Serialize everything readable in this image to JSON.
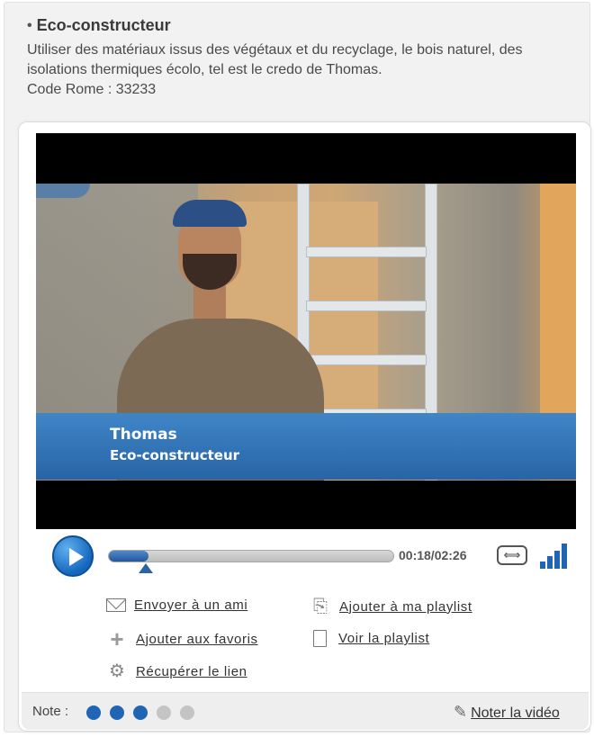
{
  "header": {
    "bullet": "•",
    "title": "Eco-constructeur",
    "description": "Utiliser des matériaux issus des végétaux et du recyclage, le bois naturel, des isolations thermiques écolo, tel est le credo de Thomas.",
    "code": "Code Rome : 33233"
  },
  "video": {
    "caption_name": "Thomas",
    "caption_role": "Eco-constructeur"
  },
  "player": {
    "time": "00:18/02:26",
    "progress_fraction": 0.12,
    "expand_symbol": "⟺",
    "accent": "#2864a6"
  },
  "actions": {
    "send_friend": "Envoyer à un ami",
    "add_playlist": "Ajouter à ma playlist",
    "add_favorites": "Ajouter aux favoris",
    "view_playlist": "Voir la playlist",
    "get_link": "Récupérer le lien"
  },
  "rating": {
    "label": "Note :",
    "filled": 3,
    "total": 5,
    "filled_color": "#1f65b4",
    "empty_color": "#c4c4c4",
    "rate_label": "Noter la vidéo",
    "pencil": "✎"
  }
}
